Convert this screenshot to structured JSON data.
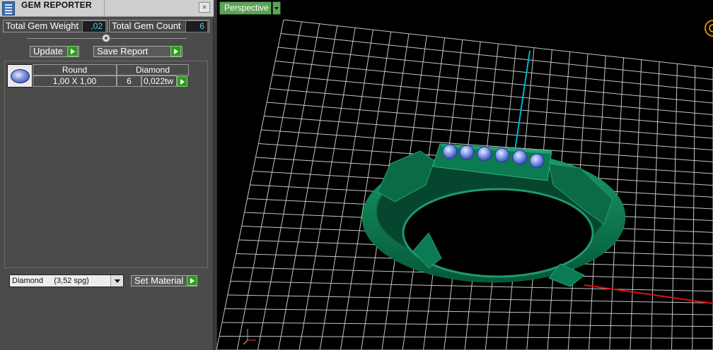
{
  "panel": {
    "title": "GEM REPORTER",
    "close_glyph": "×",
    "total_weight_label": "Total Gem Weight",
    "total_weight_value": ",02",
    "total_count_label": "Total Gem Count",
    "total_count_value": "6",
    "update_label": "Update",
    "save_report_label": "Save Report",
    "material_selected": "Diamond     (3,52 spg)",
    "set_material_label": "Set Material"
  },
  "gem_table": {
    "headers": [
      "Round",
      "Diamond"
    ],
    "rows": [
      {
        "size": "1,00 X 1,00",
        "count": "6",
        "weight": "0,022tw"
      }
    ]
  },
  "viewport": {
    "view_label": "Perspective",
    "colors": {
      "grid": "#c8c8c8",
      "ring": "#0a7a52",
      "gem": "#6f8be0",
      "axis_y": "#00b4c8",
      "axis_x": "#e01010"
    }
  }
}
